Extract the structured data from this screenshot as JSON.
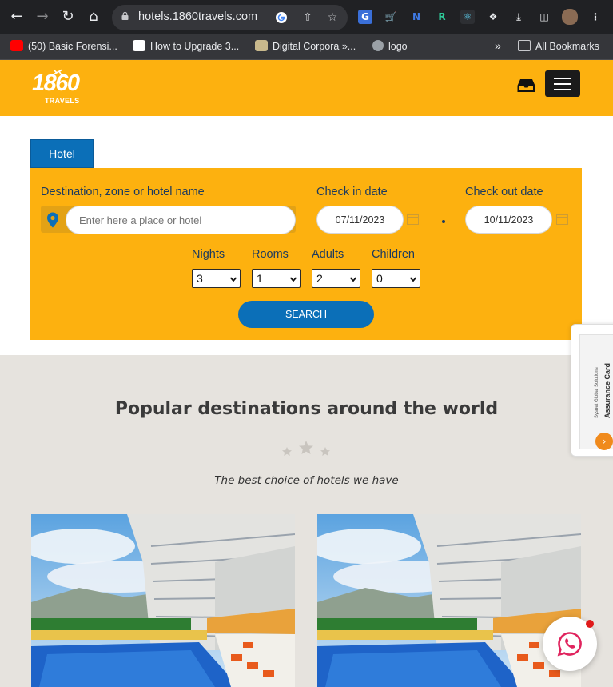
{
  "browser": {
    "url": "hotels.1860travels.com",
    "bookmarks": [
      {
        "label": "(50) Basic Forensi..."
      },
      {
        "label": "How to Upgrade 3..."
      },
      {
        "label": "Digital Corpora »..."
      },
      {
        "label": "logo"
      }
    ],
    "more_bookmarks": "»",
    "all_bookmarks": "All Bookmarks"
  },
  "header": {
    "logo_number": "1860",
    "logo_word": "TRAVELS",
    "brand_color": "#fdb10f",
    "accent_color": "#0b6fb8"
  },
  "search": {
    "tab_label": "Hotel",
    "destination_label": "Destination, zone or hotel name",
    "destination_placeholder": "Enter here a place or hotel",
    "checkin_label": "Check in date",
    "checkin_value": "07/11/2023",
    "checkout_label": "Check out date",
    "checkout_value": "10/11/2023",
    "nights_label": "Nights",
    "nights_value": "3",
    "rooms_label": "Rooms",
    "rooms_value": "1",
    "adults_label": "Adults",
    "adults_value": "2",
    "children_label": "Children",
    "children_value": "0",
    "search_button": "SEARCH"
  },
  "assurance": {
    "title": "Assurance Card",
    "subtitle": "Sysnet Global Solutions"
  },
  "popular": {
    "title": "Popular destinations around the world",
    "subtitle": "The best choice of hotels we have"
  }
}
